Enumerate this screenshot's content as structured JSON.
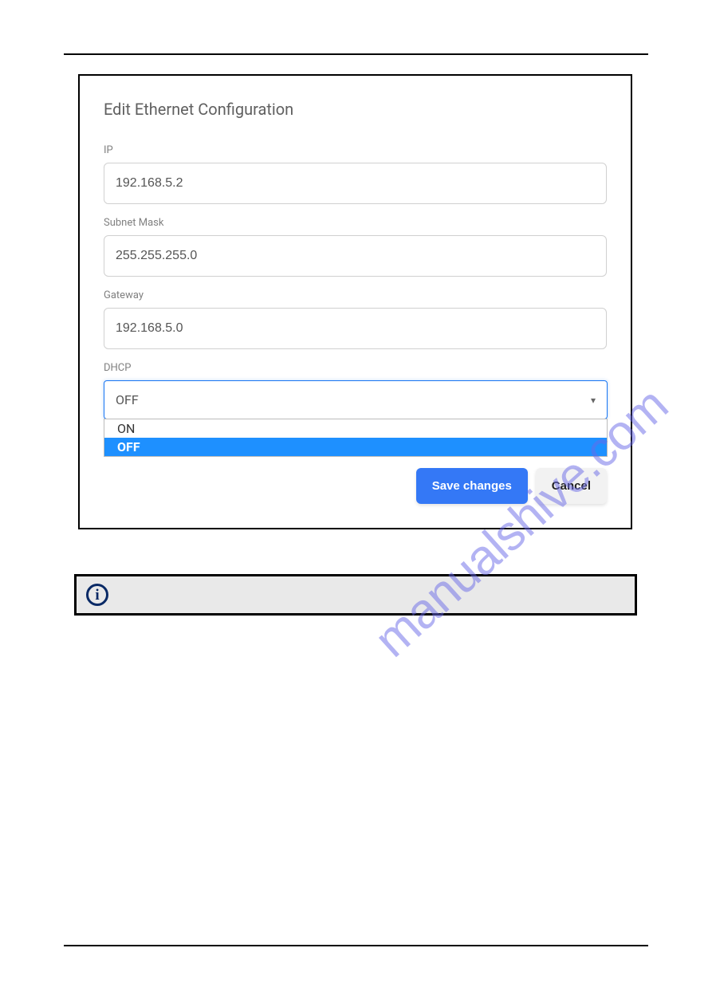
{
  "dialog": {
    "title": "Edit Ethernet Configuration",
    "fields": {
      "ip": {
        "label": "IP",
        "value": "192.168.5.2"
      },
      "subnet": {
        "label": "Subnet Mask",
        "value": "255.255.255.0"
      },
      "gateway": {
        "label": "Gateway",
        "value": "192.168.5.0"
      },
      "dhcp": {
        "label": "DHCP",
        "value": "OFF",
        "options": [
          "ON",
          "OFF"
        ]
      }
    },
    "buttons": {
      "save": "Save changes",
      "cancel": "Cancel"
    }
  },
  "watermark": "manualshive.com"
}
